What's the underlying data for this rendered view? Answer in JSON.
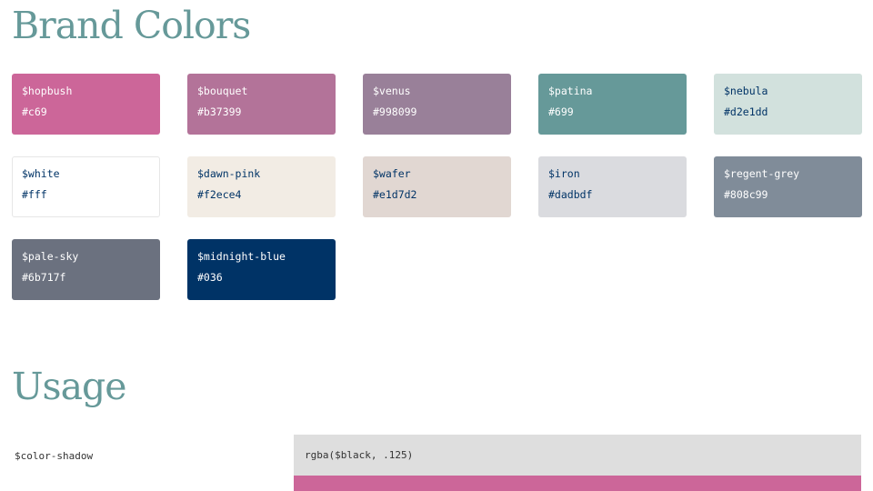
{
  "brand": {
    "title": "Brand Colors",
    "swatches": [
      {
        "name": "$hopbush",
        "hex": "#c69",
        "color": "#cc6699",
        "text": "dark"
      },
      {
        "name": "$bouquet",
        "hex": "#b37399",
        "color": "#b37399",
        "text": "dark"
      },
      {
        "name": "$venus",
        "hex": "#998099",
        "color": "#998099",
        "text": "dark"
      },
      {
        "name": "$patina",
        "hex": "#699",
        "color": "#669999",
        "text": "dark"
      },
      {
        "name": "$nebula",
        "hex": "#d2e1dd",
        "color": "#d2e1dd",
        "text": "light"
      },
      {
        "name": "$white",
        "hex": "#fff",
        "color": "#ffffff",
        "text": "light"
      },
      {
        "name": "$dawn-pink",
        "hex": "#f2ece4",
        "color": "#f2ece4",
        "text": "light"
      },
      {
        "name": "$wafer",
        "hex": "#e1d7d2",
        "color": "#e1d7d2",
        "text": "light"
      },
      {
        "name": "$iron",
        "hex": "#dadbdf",
        "color": "#dadbdf",
        "text": "light"
      },
      {
        "name": "$regent-grey",
        "hex": "#808c99",
        "color": "#808c99",
        "text": "dark"
      },
      {
        "name": "$pale-sky",
        "hex": "#6b717f",
        "color": "#6b717f",
        "text": "dark"
      },
      {
        "name": "$midnight-blue",
        "hex": "#036",
        "color": "#003366",
        "text": "dark"
      }
    ]
  },
  "usage": {
    "title": "Usage",
    "rows": [
      {
        "variable": "$color-shadow",
        "value": "rgba($black, .125)",
        "background": "#dedede"
      }
    ],
    "next_row_color": "#cc6699"
  }
}
